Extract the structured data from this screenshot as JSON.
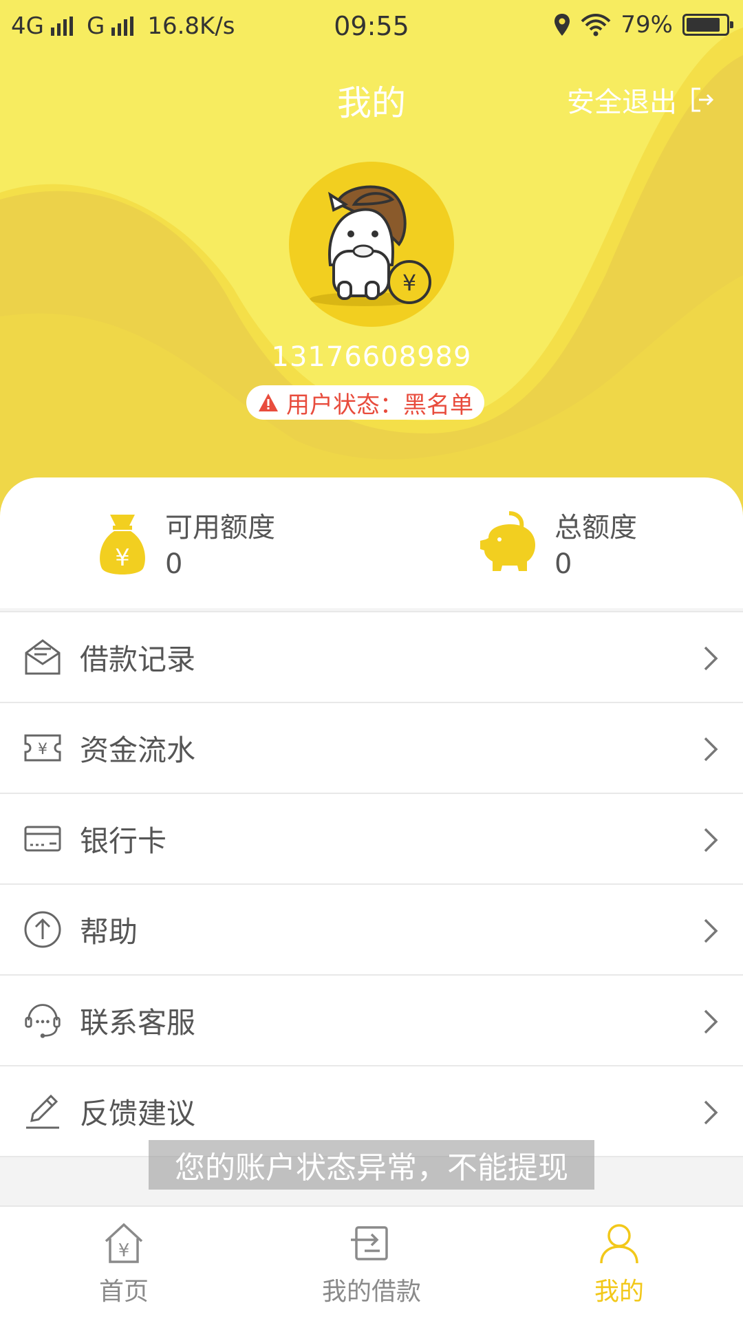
{
  "status_bar": {
    "net1": "4G",
    "net2": "G",
    "speed": "16.8K/s",
    "time": "09:55",
    "battery": "79%",
    "battery_level": 0.79
  },
  "header": {
    "title": "我的",
    "logout_label": "安全退出"
  },
  "profile": {
    "phone": "13176608989",
    "status_text": "用户状态：黑名单",
    "accent_color": "#f6e65a"
  },
  "credit": {
    "available_label": "可用额度",
    "available_value": "0",
    "total_label": "总额度",
    "total_value": "0"
  },
  "menu": {
    "items": [
      {
        "label": "借款记录",
        "icon": "mail-icon"
      },
      {
        "label": "资金流水",
        "icon": "ticket-yen-icon"
      },
      {
        "label": "银行卡",
        "icon": "card-icon"
      },
      {
        "label": "帮助",
        "icon": "arrow-up-circle-icon"
      },
      {
        "label": "联系客服",
        "icon": "headset-icon"
      },
      {
        "label": "反馈建议",
        "icon": "pencil-icon"
      }
    ]
  },
  "toast": {
    "message": "您的账户状态异常，不能提现"
  },
  "tabbar": {
    "items": [
      {
        "label": "首页",
        "icon": "home-yen-icon"
      },
      {
        "label": "我的借款",
        "icon": "loan-icon"
      },
      {
        "label": "我的",
        "icon": "user-icon",
        "active": true
      }
    ],
    "active_color": "#f2c81a"
  }
}
